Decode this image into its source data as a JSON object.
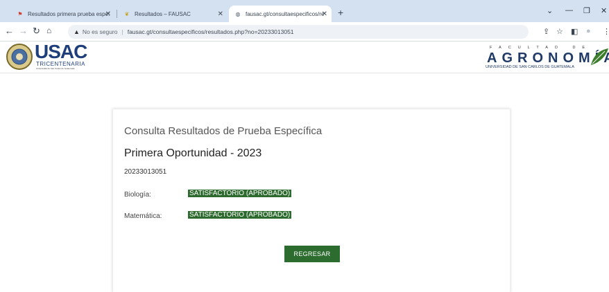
{
  "browser": {
    "tabs": [
      {
        "label": "Resultados primera prueba espe:",
        "favicon": "flag-icon"
      },
      {
        "label": "Resultados – FAUSAC",
        "favicon": "leaf-icon"
      },
      {
        "label": "fausac.gt/consultaespecificos/re",
        "favicon": "globe-icon"
      }
    ],
    "url_warning": "No es seguro",
    "url": "fausac.gt/consultaespecificos/resultados.php?no=20233013051"
  },
  "header": {
    "usac_name": "USAC",
    "usac_tagline": "TRICENTENARIA",
    "usac_small": "Universidad de San Carlos de Guatemala",
    "agro_faculty": "FACULTAD DE",
    "agro_name": "AGRONOMÍA",
    "agro_university": "UNIVERSIDAD DE SAN CARLOS DE GUATEMALA"
  },
  "card": {
    "title": "Consulta Resultados de Prueba Específica",
    "subtitle": "Primera Oportunidad - 2023",
    "student_id": "20233013051",
    "results": [
      {
        "subject": "Biología:",
        "status": "SATISFACTORIO (APROBADO)"
      },
      {
        "subject": "Matemática:",
        "status": "SATISFACTORIO (APROBADO)"
      }
    ],
    "back_button": "REGRESAR"
  }
}
